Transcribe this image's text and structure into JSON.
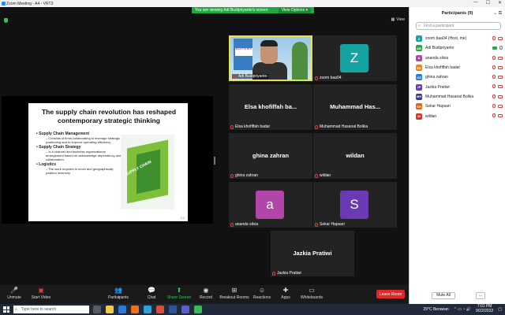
{
  "window": {
    "title": "Zoom Meeting - A4 - VRT3",
    "controls": [
      "—",
      "☐",
      "✕"
    ]
  },
  "share_banner": {
    "text": "You are viewing Adi Budipriyanto's screen",
    "view_options": "View Options ▾"
  },
  "view_button": "View",
  "slide": {
    "title": "The supply chain revolution has reshaped contemporary strategic thinking",
    "bullets": [
      {
        "heading": "Supply Chain Management",
        "sub": "Consists of firms collaborating to leverage strategic positioning and to improve operating efficiency"
      },
      {
        "heading": "Supply Chain Strategy",
        "sub": "Is a channel and business organizational arrangement based on acknowledge dependency and collaboration"
      },
      {
        "heading": "Logistics",
        "sub": "The work required to move and geographically position inventory"
      }
    ],
    "book_caption": "SUPPLY CHAIN",
    "page_number": "1-2"
  },
  "tiles": [
    {
      "id": "adi",
      "label": "Adi Budipriyanto",
      "type": "video"
    },
    {
      "id": "zoom",
      "label": "zoom baa04",
      "avatar": "Z",
      "avatar_color": "#14a3a0"
    },
    {
      "id": "elsa",
      "name": "Elsa khofiffah ba...",
      "label": "Elsa khofiffah badar"
    },
    {
      "id": "muh",
      "name": "Muhammad Has...",
      "label": "Muhammad Hasanal Bolkia"
    },
    {
      "id": "ghina",
      "name": "ghina zahran",
      "label": "ghina zahran"
    },
    {
      "id": "wildan",
      "name": "wildan",
      "label": "wildan"
    },
    {
      "id": "ananda",
      "label": "ananda silvia",
      "avatar": "a",
      "avatar_color": "#b246a8"
    },
    {
      "id": "sekar",
      "label": "Sekar Hapsari",
      "avatar": "S",
      "avatar_color": "#6a3ab5"
    },
    {
      "id": "jazkia",
      "name": "Jazkia Pratiwi",
      "label": "Jazkia Pratiwi"
    }
  ],
  "toolbar": {
    "unmute": "Unmute",
    "start_video": "Start Video",
    "participants": "Participants",
    "participants_count": "9",
    "chat": "Chat",
    "share_screen": "Share Screen",
    "record": "Record",
    "breakout": "Breakout Rooms",
    "reactions": "Reactions",
    "apps": "Apps",
    "whiteboards": "Whiteboards",
    "leave": "Leave Room"
  },
  "participants_panel": {
    "title": "Participants (9)",
    "search_placeholder": "Find a participant",
    "mute_all": "Mute All",
    "more": "...",
    "items": [
      {
        "initials": "Z",
        "name": "zoom baa04 (Host, me)",
        "color": "#14a3a0",
        "cam_on": false
      },
      {
        "initials": "AB",
        "name": "Adi Budipriyanto",
        "color": "#2ea34a",
        "cam_on": true
      },
      {
        "initials": "A",
        "name": "ananda silvia",
        "color": "#b246a8",
        "cam_on": false
      },
      {
        "initials": "EK",
        "name": "Elsa khofiffah badar",
        "color": "#e8851a",
        "cam_on": false
      },
      {
        "initials": "GZ",
        "name": "ghina zahran",
        "color": "#2a7bd4",
        "cam_on": false
      },
      {
        "initials": "JP",
        "name": "Jazkia Pratiwi",
        "color": "#6a3ab5",
        "cam_on": false
      },
      {
        "initials": "MH",
        "name": "Muhammad Hasanal Bolkia",
        "color": "#3a3a8c",
        "cam_on": false
      },
      {
        "initials": "SH",
        "name": "Sekar Hapsari",
        "color": "#d4681e",
        "cam_on": false
      },
      {
        "initials": "W",
        "name": "wildan",
        "color": "#d4352b",
        "cam_on": false
      }
    ]
  },
  "taskbar": {
    "search_placeholder": "Type here to search",
    "weather": "29°C Berawan",
    "time": "7:01 PM",
    "date": "9/22/2022"
  }
}
